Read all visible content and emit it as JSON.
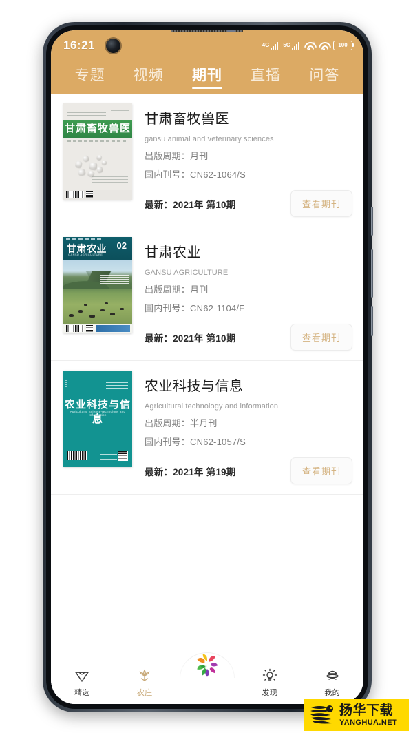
{
  "status_bar": {
    "time": "16:21",
    "network_4g": "4G",
    "network_5g": "5G",
    "battery": "100",
    "icons": [
      "signal-4g-icon",
      "signal-5g-icon",
      "wifi-icon",
      "wifi-icon",
      "battery-icon"
    ]
  },
  "top_tabs": {
    "items": [
      {
        "label": "专题",
        "active": false
      },
      {
        "label": "视频",
        "active": false
      },
      {
        "label": "期刊",
        "active": true
      },
      {
        "label": "直播",
        "active": false
      },
      {
        "label": "问答",
        "active": false
      }
    ],
    "background_color": "#dcaa64",
    "active_color": "#ffffff"
  },
  "journals": [
    {
      "title": "甘肃畜牧兽医",
      "subtitle_en": "gansu animal and veterinary sciences",
      "period_label": "出版周期：",
      "period_value": "月刊",
      "cn_number_label": "国内刊号：",
      "cn_number_value": "CN62-1064/S",
      "latest": "最新：2021年 第10期",
      "button_label": "查看期刊",
      "cover": {
        "type": "vet",
        "cover_title": "甘肃畜牧兽医",
        "band_color": "#3f9c52",
        "bg_color": "#eceae6"
      }
    },
    {
      "title": "甘肃农业",
      "subtitle_en": "GANSU AGRICULTURE",
      "period_label": "出版周期：",
      "period_value": "月刊",
      "cn_number_label": "国内刊号：",
      "cn_number_value": "CN62-1104/F",
      "latest": "最新：2021年 第10期",
      "button_label": "查看期刊",
      "cover": {
        "type": "agri",
        "cover_title": "甘肃农业",
        "cover_en": "GANSU AGRICULTURE",
        "issue_number": "02",
        "header_color": "#0f5e6b"
      }
    },
    {
      "title": "农业科技与信息",
      "subtitle_en": "Agricultural technology and information",
      "period_label": "出版周期：",
      "period_value": "半月刊",
      "cn_number_label": "国内刊号：",
      "cn_number_value": "CN62-1057/S",
      "latest": "最新：2021年 第19期",
      "button_label": "查看期刊",
      "cover": {
        "type": "tech",
        "cover_title": "农业科技与信息",
        "cover_en": "Agricultural Science-technology and Information",
        "bg_color": "#129391"
      }
    }
  ],
  "bottom_nav": {
    "items": [
      {
        "label": "精选",
        "icon": "heart-diamond-icon",
        "active": false
      },
      {
        "label": "农庄",
        "icon": "lotus-icon",
        "active": true
      },
      {
        "label": "",
        "icon": "flower-logo-icon",
        "active": false
      },
      {
        "label": "发现",
        "icon": "lightbulb-icon",
        "active": false
      },
      {
        "label": "我的",
        "icon": "person-icon",
        "active": false
      }
    ],
    "active_color": "#c8a978"
  },
  "watermark": {
    "cn": "扬华下载",
    "en": "YANGHUA.NET",
    "bg_color": "#ffd900"
  }
}
